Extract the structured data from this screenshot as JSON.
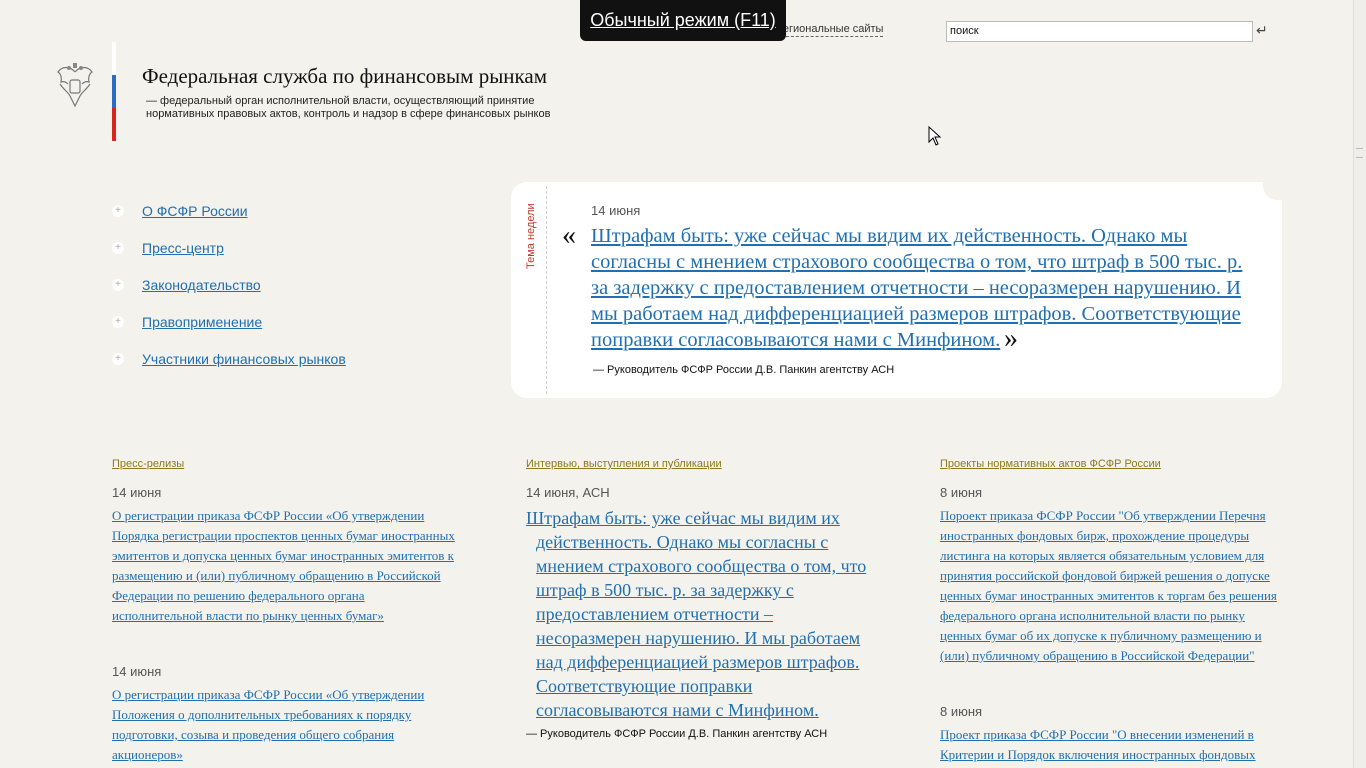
{
  "fullscreen_notice": "Обычный режим (F11)",
  "regional_link": "Региональные сайты",
  "search": {
    "value": "поиск",
    "submit_icon": "enter-icon"
  },
  "header": {
    "title": "Федеральная служба по финансовым рынкам",
    "subtitle": "— федеральный орган исполнительной власти, осуществляющий принятие нормативных правовых актов, контроль и надзор в сфере финансовых рынков",
    "flag_colors": [
      "#ffffff",
      "#2b6cc4",
      "#d6261d"
    ]
  },
  "nav": {
    "items": [
      {
        "label": "О ФСФР России"
      },
      {
        "label": "Пресс-центр"
      },
      {
        "label": "Законодательство"
      },
      {
        "label": "Правоприменение"
      },
      {
        "label": "Участники финансовых рынков"
      }
    ]
  },
  "week": {
    "label": "Тема недели",
    "date": "14 июня",
    "quote_open": "«",
    "quote_close": "»",
    "quote": "Штрафам быть: уже сейчас мы видим их действенность. Однако мы согласны с мнением страхового сообщества о том, что штраф в 500 тыс. р. за задержку с предоставлением отчетности – несоразмерен нарушению. И мы работаем над дифференциацией размеров штрафов. Соответствующие поправки согласовываются нами с Минфином.",
    "source": "— Руководитель ФСФР России Д.В. Панкин агентству АСН"
  },
  "columns": {
    "press": {
      "heading": "Пресс-релизы",
      "items": [
        {
          "date": "14 июня",
          "text": "О регистрации приказа ФСФР России «Об утверждении Порядка регистрации проспектов ценных бумаг иностранных эмитентов и допуска ценных бумаг иностранных эмитентов к размещению и (или) публичному обращению в Российской Федерации по решению федерального органа исполнительной власти по рынку ценных бумаг»"
        },
        {
          "date": "14 июня",
          "text": "О регистрации приказа ФСФР России «Об утверждении Положения о дополнительных требованиях к порядку подготовки, созыва и проведения общего собрания акционеров»"
        }
      ]
    },
    "interviews": {
      "heading": "Интервью, выступления и публикации",
      "date": "14 июня, АСН",
      "text": "Штрафам быть: уже сейчас мы видим их действенность. Однако мы согласны с мнением страхового сообщества о том, что штраф в 500 тыс. р. за задержку с предоставлением отчетности – несоразмерен нарушению. И мы работаем над дифференциацией размеров штрафов. Соответствующие поправки согласовываются нами с Минфином.",
      "source": "— Руководитель ФСФР России Д.В. Панкин агентству АСН"
    },
    "projects": {
      "heading": "Проекты нормативных актов ФСФР России",
      "items": [
        {
          "date": "8 июня",
          "text": "Пороект приказа ФСФР России \"Об утверждении Перечня иностранных фондовых бирж, прохождение процедуры листинга на которых является обязательным условием для принятия российской фондовой биржей решения о допуске ценных бумаг иностранных эмитентов к торгам без решения федерального органа исполнительной власти по рынку ценных бумаг об их допуске к публичному размещению и (или) публичному обращению в Российской Федерации\""
        },
        {
          "date": "8 июня",
          "text": "Проект приказа ФСФР России \"О внесении изменений в Критерии и Порядок включения иностранных фондовых"
        }
      ]
    }
  }
}
